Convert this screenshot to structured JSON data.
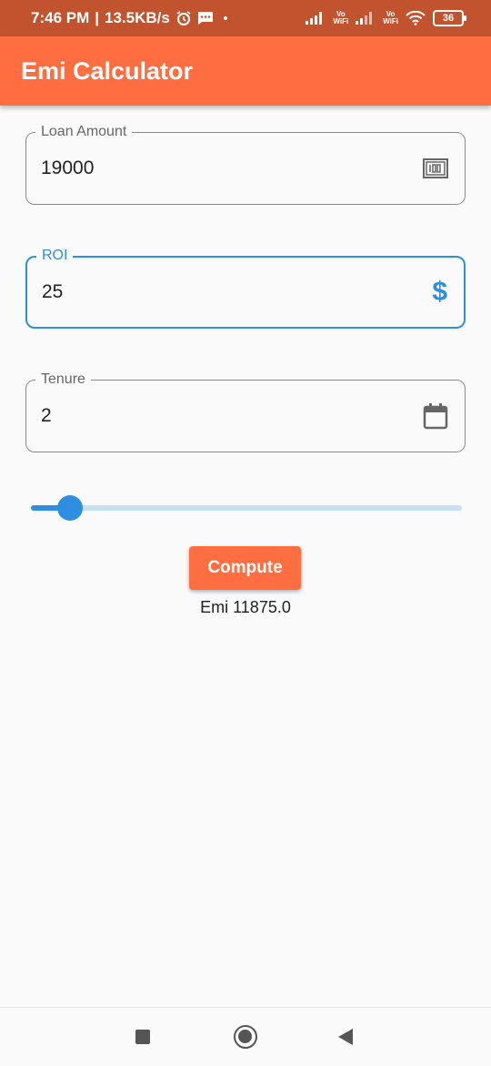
{
  "status_bar": {
    "time": "7:46 PM",
    "speed": "13.5KB/s",
    "vowifi_top": "Vo",
    "vowifi_bottom": "WiFi",
    "battery": "36"
  },
  "app_bar": {
    "title": "Emi Calculator"
  },
  "form": {
    "loan_amount": {
      "label": "Loan Amount",
      "value": "19000",
      "icon": "money-icon"
    },
    "roi": {
      "label": "ROI",
      "value": "25",
      "icon": "dollar-icon",
      "icon_text": "$"
    },
    "tenure": {
      "label": "Tenure",
      "value": "2",
      "icon": "calendar-icon"
    }
  },
  "slider": {
    "fraction": 0.09
  },
  "compute_button": {
    "label": "Compute"
  },
  "result": {
    "text": "Emi 11875.0"
  },
  "colors": {
    "status_bar": "#c2532f",
    "app_bar": "#ff6e40",
    "accent": "#2f8ee0",
    "background": "#fafafa"
  }
}
